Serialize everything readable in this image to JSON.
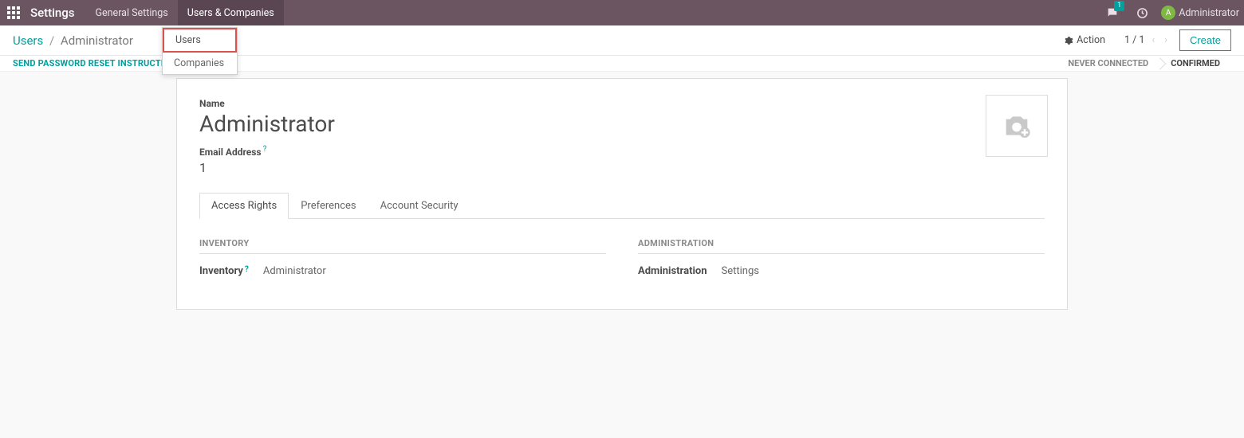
{
  "topnav": {
    "brand": "Settings",
    "items": [
      {
        "label": "General Settings"
      },
      {
        "label": "Users & Companies",
        "active": true
      }
    ],
    "chat_badge": "1",
    "user_initial": "A",
    "username": "Administrator"
  },
  "dropdown": {
    "users": "Users",
    "companies": "Companies"
  },
  "breadcrumb": {
    "root": "Users",
    "current": "Administrator"
  },
  "actions": {
    "action_label": "Action",
    "pager": "1 / 1",
    "create_label": "Create"
  },
  "secondbar": {
    "reset_link": "SEND PASSWORD RESET INSTRUCTIONS",
    "status_never": "NEVER CONNECTED",
    "status_confirmed": "CONFIRMED"
  },
  "form": {
    "name_label": "Name",
    "name_value": "Administrator",
    "email_label": "Email Address",
    "email_value": "1",
    "tabs": {
      "access_rights": "Access Rights",
      "preferences": "Preferences",
      "account_security": "Account Security"
    },
    "inventory": {
      "header": "INVENTORY",
      "label": "Inventory",
      "value": "Administrator"
    },
    "administration": {
      "header": "ADMINISTRATION",
      "label": "Administration",
      "value": "Settings"
    }
  }
}
